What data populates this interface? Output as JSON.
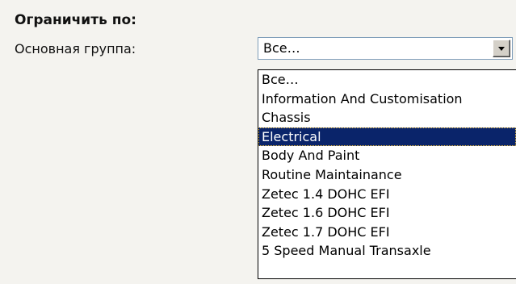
{
  "filter": {
    "title": "Ограничить по:",
    "main_group_label": "Основная группа:",
    "selected_value": "Все…"
  },
  "dropdown": {
    "options": [
      "Все…",
      "Information And Customisation",
      "Chassis",
      "Electrical",
      "Body And Paint",
      "Routine Maintainance",
      "Zetec 1.4 DOHC EFI",
      "Zetec 1.6 DOHC EFI",
      "Zetec 1.7 DOHC EFI",
      "5 Speed Manual Transaxle"
    ],
    "highlighted_option": "Electrical"
  },
  "colors": {
    "highlight_bg": "#0a246a",
    "highlight_text": "#ffffff",
    "page_bg": "#f4f3ef",
    "field_border": "#7f9db9"
  },
  "icons": {
    "dropdown_button": "chevron-down-icon"
  }
}
